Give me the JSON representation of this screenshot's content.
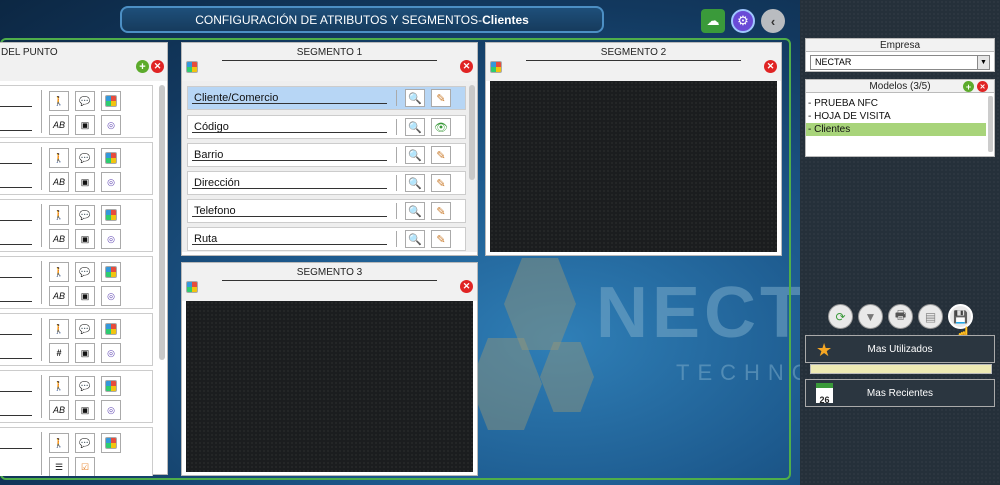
{
  "header": {
    "title_prefix": "CONFIGURACIÓN DE ATRIBUTOS Y SEGMENTOS- ",
    "title_bold": "Clientes"
  },
  "left_panel": {
    "title": "DEL PUNTO",
    "rows": [
      {
        "btn4": "AB"
      },
      {
        "btn4": "AB"
      },
      {
        "btn4": "AB"
      },
      {
        "btn4": "AB"
      },
      {
        "btn4": "#"
      },
      {
        "btn4": "AB"
      },
      {
        "btn4": "☰"
      }
    ]
  },
  "segmento1": {
    "title": "SEGMENTO 1",
    "rows": [
      {
        "label": "Cliente/Comercio",
        "active": true
      },
      {
        "label": "Código",
        "active": false
      },
      {
        "label": "Barrio",
        "active": false
      },
      {
        "label": "Dirección",
        "active": false
      },
      {
        "label": "Telefono",
        "active": false
      },
      {
        "label": "Ruta",
        "active": false
      }
    ]
  },
  "segmento2": {
    "title": "SEGMENTO 2"
  },
  "segmento3": {
    "title": "SEGMENTO 3"
  },
  "watermark": {
    "line1": "NECT",
    "line2": "TECHNO"
  },
  "sidebar": {
    "empresa_label": "Empresa",
    "empresa_value": "NECTAR",
    "modelos_label": "Modelos (3/5)",
    "modelos": [
      {
        "label": "- PRUEBA NFC",
        "selected": false
      },
      {
        "label": "- HOJA DE VISITA",
        "selected": false
      },
      {
        "label": "- Clientes",
        "selected": true
      }
    ],
    "mas_utilizados": "Mas Utilizados",
    "mas_recientes": "Mas Recientes",
    "calendar_day": "26"
  },
  "colors": {
    "accent_green": "#4fae4a",
    "active_row": "#b7d6f5",
    "selected_model": "#a8d47a",
    "close_red": "#e02424"
  }
}
